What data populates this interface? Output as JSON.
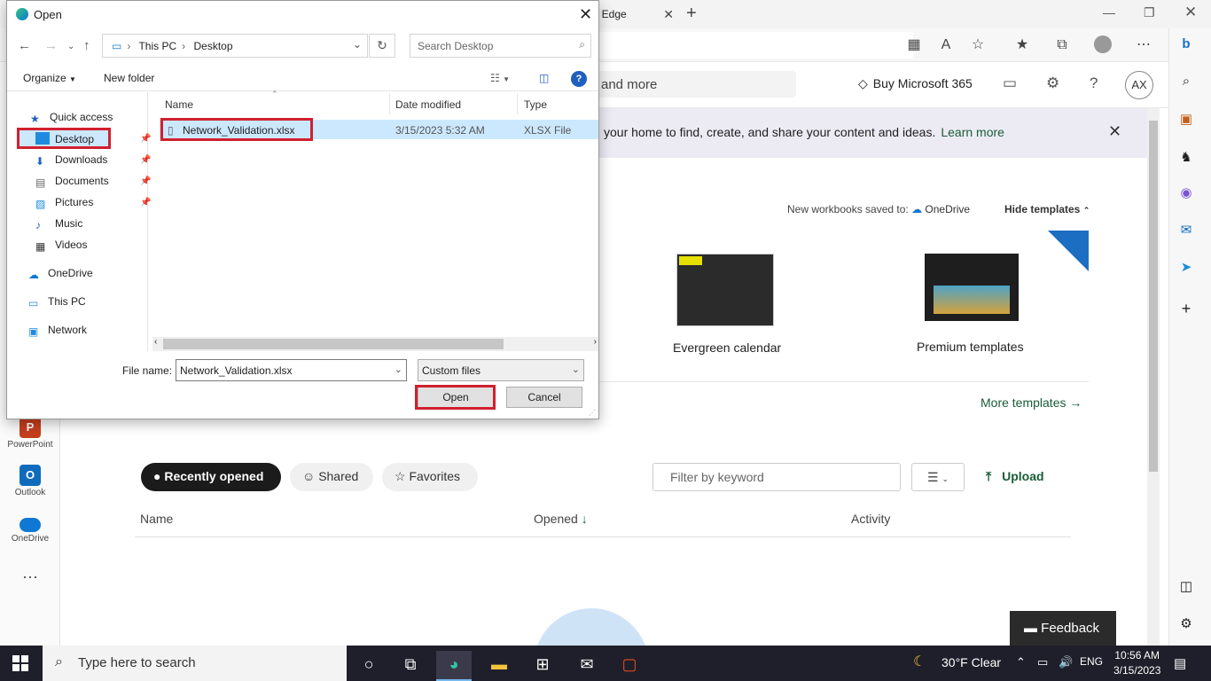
{
  "browser": {
    "tab_label": "t Edge",
    "sidebar_apps": [
      "bing-icon",
      "search-icon",
      "briefcase-icon",
      "chess-icon",
      "copilot-icon",
      "outlook-icon",
      "send-icon",
      "add-icon"
    ]
  },
  "excel": {
    "search_placeholder": "and more",
    "buy_label": "Buy Microsoft 365",
    "avatar_initials": "AX",
    "banner_text": "your home to find, create, and share your content and ideas.",
    "banner_link": "Learn more",
    "saved_to_label": "New workbooks saved to:",
    "saved_to_location": "OneDrive",
    "hide_templates": "Hide templates",
    "templates": [
      {
        "label": "Evergreen calendar"
      },
      {
        "label": "Premium templates"
      }
    ],
    "more_templates": "More templates",
    "tabs": [
      "Recently opened",
      "Shared",
      "Favorites"
    ],
    "filter_placeholder": "Filter by keyword",
    "upload_label": "Upload",
    "columns": [
      "Name",
      "Opened",
      "Activity"
    ],
    "feedback_label": "Feedback",
    "rail": [
      {
        "label": "PowerPoint",
        "color": "#c43e1c",
        "glyph": "P"
      },
      {
        "label": "Outlook",
        "color": "#0f6cbd",
        "glyph": "O"
      },
      {
        "label": "OneDrive",
        "color": "#0f78d4",
        "glyph": ""
      }
    ]
  },
  "dialog": {
    "title": "Open",
    "path": [
      "This PC",
      "Desktop"
    ],
    "search_placeholder": "Search Desktop",
    "organize_label": "Organize",
    "new_folder_label": "New folder",
    "nav_items": [
      {
        "label": "Quick access",
        "icon": "star-icon"
      },
      {
        "label": "Desktop",
        "icon": "desktop-icon",
        "pinned": true,
        "selected": true
      },
      {
        "label": "Downloads",
        "icon": "download-icon",
        "pinned": true
      },
      {
        "label": "Documents",
        "icon": "documents-icon",
        "pinned": true
      },
      {
        "label": "Pictures",
        "icon": "pictures-icon",
        "pinned": true
      },
      {
        "label": "Music",
        "icon": "music-icon"
      },
      {
        "label": "Videos",
        "icon": "videos-icon"
      },
      {
        "label": "OneDrive",
        "icon": "cloud-icon"
      },
      {
        "label": "This PC",
        "icon": "pc-icon"
      },
      {
        "label": "Network",
        "icon": "network-icon"
      }
    ],
    "columns": [
      "Name",
      "Date modified",
      "Type"
    ],
    "files": [
      {
        "name": "Network_Validation.xlsx",
        "date": "3/15/2023 5:32 AM",
        "type": "XLSX File"
      }
    ],
    "file_name_label": "File name:",
    "file_name_value": "Network_Validation.xlsx",
    "file_type_value": "Custom files",
    "open_label": "Open",
    "cancel_label": "Cancel"
  },
  "taskbar": {
    "search_placeholder": "Type here to search",
    "weather": "30°F  Clear",
    "language": "ENG",
    "time": "10:56 AM",
    "date": "3/15/2023"
  }
}
